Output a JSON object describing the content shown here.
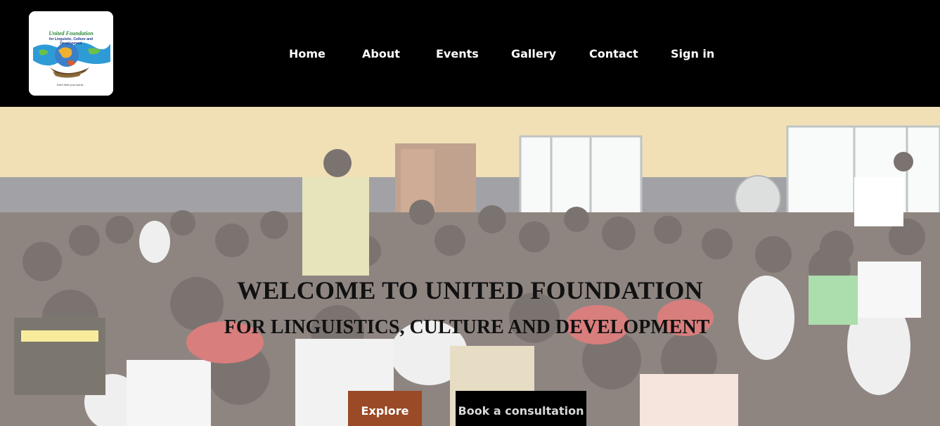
{
  "logo": {
    "line1": "United Foundation",
    "line2": "for Linguistic, Culture and",
    "line3": "Development",
    "tagline": "Don't limit your world..."
  },
  "nav": {
    "items": [
      {
        "id": "home",
        "label": "Home"
      },
      {
        "id": "about",
        "label": "About"
      },
      {
        "id": "events",
        "label": "Events"
      },
      {
        "id": "gallery",
        "label": "Gallery"
      },
      {
        "id": "contact",
        "label": "Contact"
      },
      {
        "id": "signin",
        "label": "Sign in"
      }
    ]
  },
  "hero": {
    "title": "WELCOME TO UNITED FOUNDATION",
    "subtitle": "FOR LINGUISTICS, CULTURE AND DEVELOPMENT",
    "buttons": {
      "explore": "Explore",
      "consultation": "Book a consultation"
    }
  },
  "colors": {
    "navbar_bg": "#000000",
    "explore_button": "#9a4a27",
    "consult_button": "#000000"
  }
}
